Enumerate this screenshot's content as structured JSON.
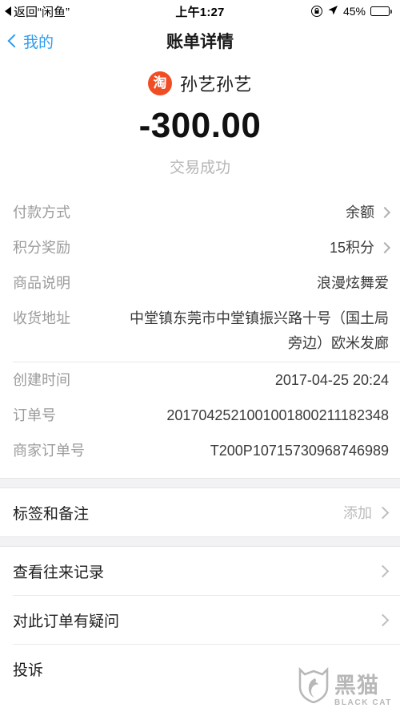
{
  "status_bar": {
    "back_label": "返回“闲鱼”",
    "time": "上午1:27",
    "battery_percent": "45%",
    "battery_level": 45,
    "icons": [
      "back-triangle-icon",
      "rotation-lock-icon",
      "location-arrow-icon",
      "battery-icon"
    ]
  },
  "nav": {
    "back_label": "我的",
    "title": "账单详情",
    "accent_color": "#2d9cf0"
  },
  "summary": {
    "merchant_logo_glyph": "淘",
    "merchant_logo_color": "#f04d24",
    "merchant_name": "孙艺孙艺",
    "amount": "-300.00",
    "trade_status": "交易成功"
  },
  "details": [
    {
      "label": "付款方式",
      "value": "余额",
      "chevron": true
    },
    {
      "label": "积分奖励",
      "value": "15积分",
      "chevron": true
    },
    {
      "label": "商品说明",
      "value": "浪漫炫舞爱",
      "chevron": false
    },
    {
      "label": "收货地址",
      "value": "中堂镇东莞市中堂镇振兴路十号（国土局旁边）欧米发廊",
      "chevron": false
    }
  ],
  "order_info": [
    {
      "label": "创建时间",
      "value": "2017-04-25 20:24"
    },
    {
      "label": "订单号",
      "value": "2017042521001001800211182348"
    },
    {
      "label": "商家订单号",
      "value": "T200P10715730968746989"
    }
  ],
  "tag_row": {
    "label": "标签和备注",
    "action": "添加"
  },
  "actions": [
    {
      "label": "查看往来记录",
      "chevron": true
    },
    {
      "label": "对此订单有疑问",
      "chevron": true
    },
    {
      "label": "投诉",
      "chevron": false
    }
  ],
  "watermark": {
    "cn": "黑猫",
    "en": "BLACK CAT"
  }
}
